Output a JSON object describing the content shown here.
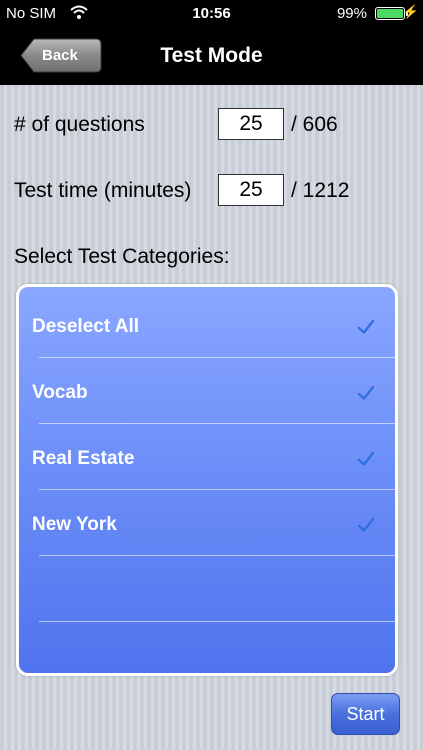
{
  "status_bar": {
    "carrier": "No SIM",
    "wifi_icon": "wifi-icon",
    "time": "10:56",
    "battery": "99%",
    "battery_level": 0.99
  },
  "nav": {
    "back_label": "Back",
    "title": "Test Mode"
  },
  "settings": {
    "questions_label": "# of questions",
    "questions_value": "25",
    "questions_total": "/ 606",
    "time_label": "Test time (minutes)",
    "time_value": "25",
    "time_total": "/ 1212"
  },
  "categories": {
    "header": "Select Test Categories:",
    "items": [
      {
        "label": "Deselect All",
        "checked": true
      },
      {
        "label": "Vocab",
        "checked": true
      },
      {
        "label": "Real Estate",
        "checked": true
      },
      {
        "label": "New York",
        "checked": true
      }
    ]
  },
  "start_label": "Start",
  "colors": {
    "list_top": "#8aa7ff",
    "list_bottom": "#4f74ee",
    "checkmark": "#2f6fe0"
  }
}
